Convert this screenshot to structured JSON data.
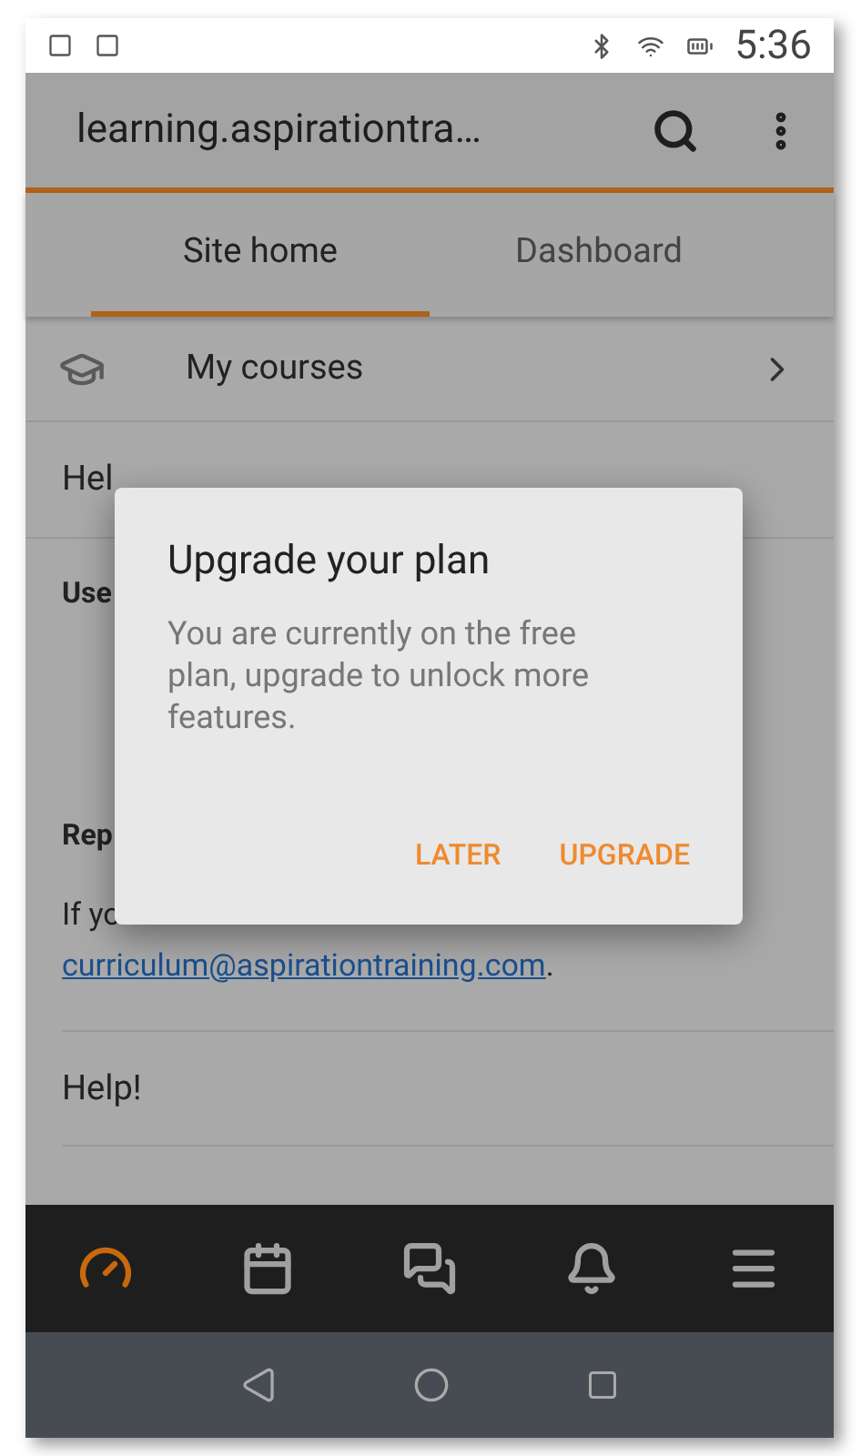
{
  "status_bar": {
    "time": "5:36"
  },
  "toolbar": {
    "title": "learning.aspirationtra…"
  },
  "tabs": [
    {
      "label": "Site home",
      "selected": true
    },
    {
      "label": "Dashboard",
      "selected": false
    }
  ],
  "menu": [
    {
      "kind": "course",
      "label": "My courses"
    },
    {
      "kind": "plain",
      "label": "Hel"
    }
  ],
  "sections": [
    {
      "heading": "Use"
    },
    {
      "heading": "Rep",
      "text": "If yo",
      "link": "curriculum@aspirationtraining.com",
      "after": "."
    }
  ],
  "help_item": {
    "label": "Help!"
  },
  "bottom_nav": [
    {
      "kind": "dashboard",
      "selected": true
    },
    {
      "kind": "calendar",
      "selected": false
    },
    {
      "kind": "messages",
      "selected": false
    },
    {
      "kind": "notifications",
      "selected": false
    },
    {
      "kind": "menu",
      "selected": false
    }
  ],
  "dialog": {
    "title": "Upgrade your plan",
    "message": "You are currently on the free plan, upgrade to unlock more features.",
    "buttons": [
      "LATER",
      "UPGRADE"
    ]
  }
}
